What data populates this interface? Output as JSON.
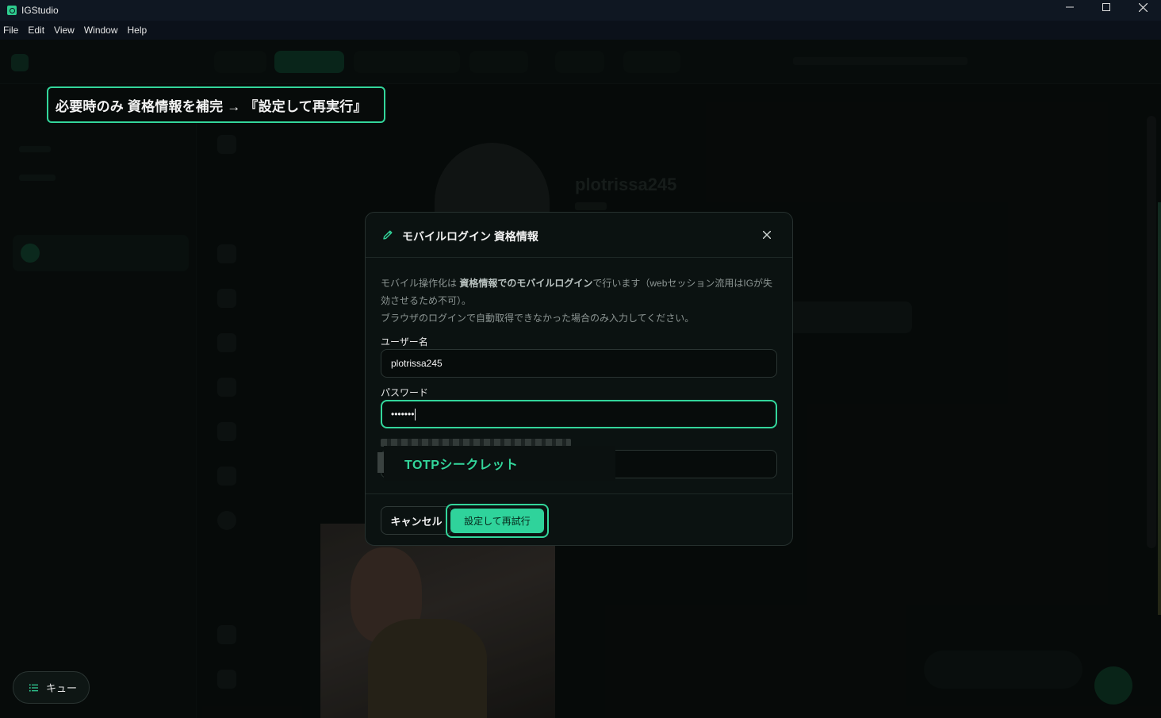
{
  "window": {
    "title": "IGStudio",
    "controls": [
      "minimize-icon",
      "maximize-icon",
      "close-icon"
    ]
  },
  "menu": [
    "File",
    "Edit",
    "View",
    "Window",
    "Help"
  ],
  "background": {
    "profile_name": "plotrissa245"
  },
  "callout": {
    "text": "必要時のみ 資格情報を補完 → 『設定して再実行』"
  },
  "modal": {
    "title": "モバイルログイン 資格情報",
    "description": {
      "part1": "モバイル操作化は ",
      "bold": "資格情報でのモバイルログイン",
      "part2": "で行います（webセッション流用はIGが失効させるため不可）。",
      "line2": "ブラウザのログインで自動取得できなかった場合のみ入力してください。"
    },
    "username_label": "ユーザー名",
    "username_value": "plotrissa245",
    "password_label": "パスワード",
    "password_value": "•••••••",
    "totp_overlay_label": "TOTPシークレット",
    "cancel_label": "キャンセル",
    "retry_label": "設定して再試行"
  },
  "queue": {
    "label": "キュー"
  },
  "colors": {
    "accent": "#33d69b",
    "modal_bg": "#0b1211",
    "app_bg": "#0a100e"
  }
}
